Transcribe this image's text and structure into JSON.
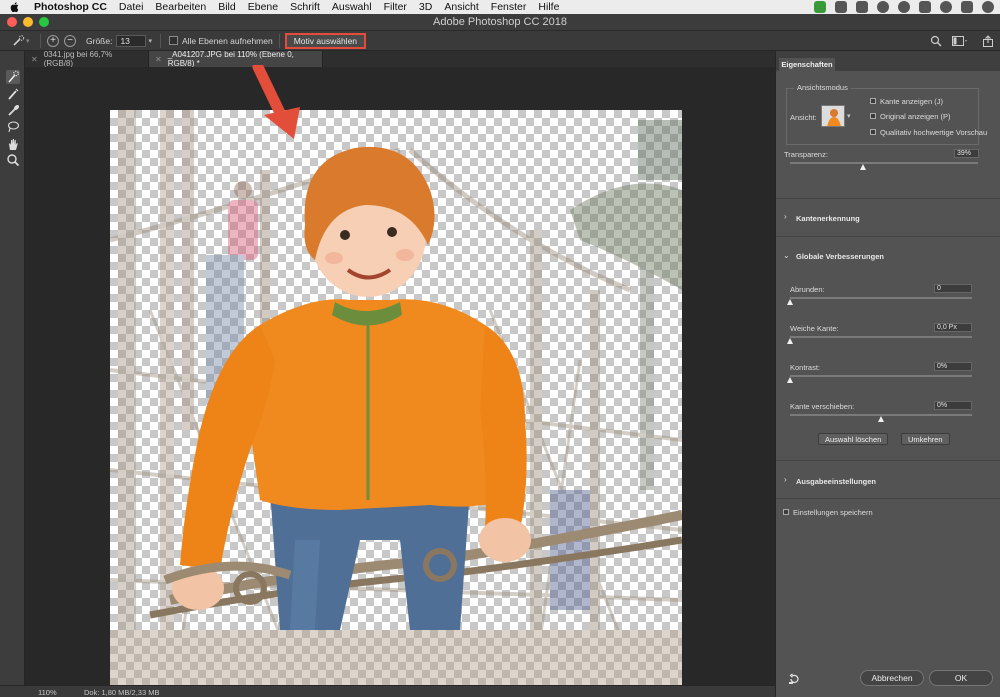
{
  "menubar": {
    "app_name": "Photoshop CC",
    "items": [
      "Datei",
      "Bearbeiten",
      "Bild",
      "Ebene",
      "Schrift",
      "Auswahl",
      "Filter",
      "3D",
      "Ansicht",
      "Fenster",
      "Hilfe"
    ]
  },
  "window": {
    "title": "Adobe Photoshop CC 2018"
  },
  "options": {
    "size_label": "Größe:",
    "size_value": "13",
    "all_layers_label": "Alle Ebenen aufnehmen",
    "select_subject_label": "Motiv auswählen",
    "highlight_color": "#e44b3a"
  },
  "tabs": [
    {
      "label": "0341.jpg bei 66,7% (RGB/8)"
    },
    {
      "label": "_A041207.JPG bei 110% (Ebene 0, RGB/8) *"
    }
  ],
  "status": {
    "zoom": "110%",
    "doc": "Dok: 1,80 MB/2,33 MB"
  },
  "properties": {
    "tab": "Eigenschaften",
    "view_mode": {
      "legend": "Ansichtsmodus",
      "view_label": "Ansicht:",
      "options": [
        "Kante anzeigen (J)",
        "Original anzeigen (P)",
        "Qualitativ hochwertige Vorschau"
      ]
    },
    "transparency": {
      "label": "Transparenz:",
      "value": "39%",
      "level": 0.39
    },
    "edge_detection": {
      "title": "Kantenerkennung"
    },
    "global": {
      "title": "Globale Verbesserungen",
      "smooth": {
        "label": "Abrunden:",
        "value": "0",
        "level": 0
      },
      "feather": {
        "label": "Weiche Kante:",
        "value": "0,0 Px",
        "level": 0
      },
      "contrast": {
        "label": "Kontrast:",
        "value": "0%",
        "level": 0
      },
      "shift_edge": {
        "label": "Kante verschieben:",
        "value": "0%",
        "level": 0.5
      },
      "clear_selection": "Auswahl löschen",
      "invert": "Umkehren"
    },
    "output": {
      "title": "Ausgabeeinstellungen"
    },
    "remember": "Einstellungen speichern",
    "cancel": "Abbrechen",
    "ok": "OK"
  }
}
